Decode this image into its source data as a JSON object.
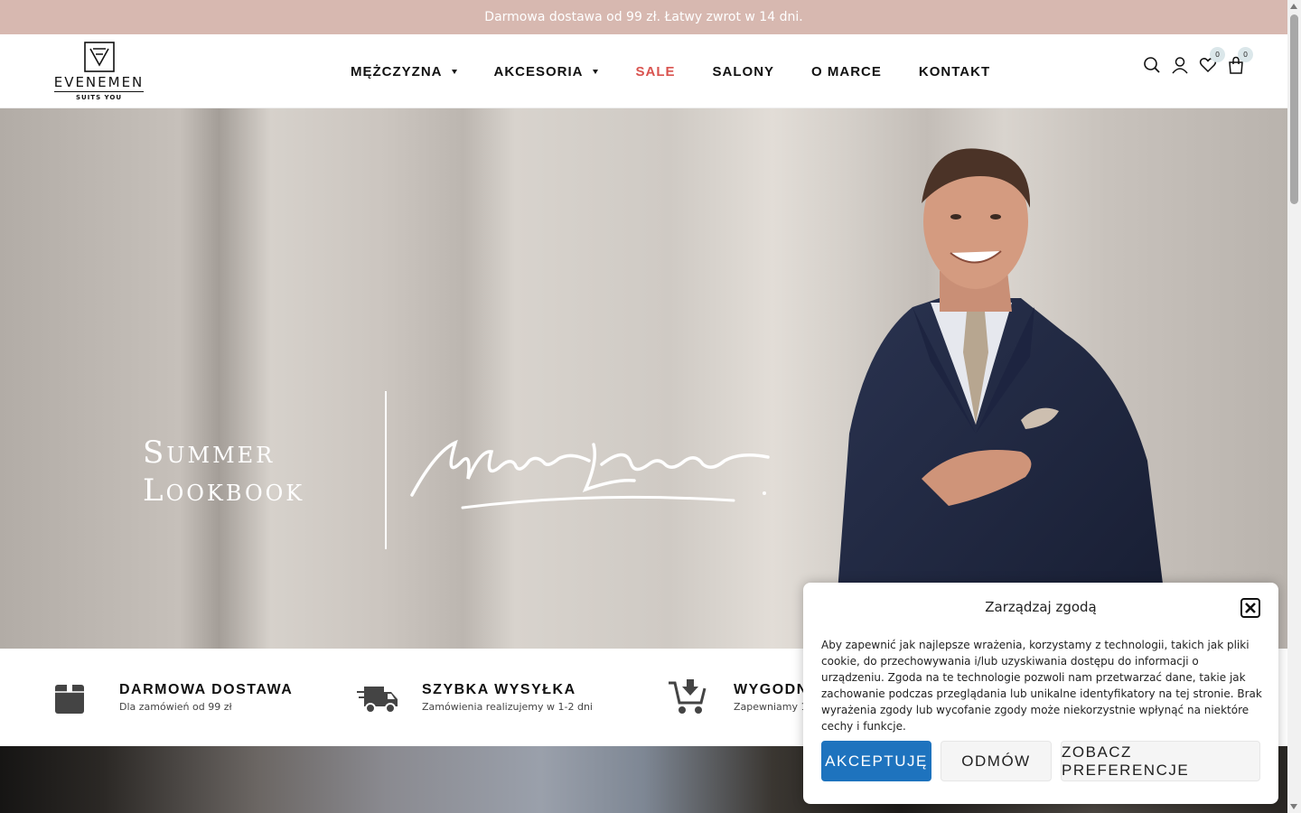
{
  "topbar": {
    "text": "Darmowa dostawa od 99 zł. Łatwy zwrot w 14 dni."
  },
  "logo": {
    "wordmark": "EVENEMEN",
    "tagline": "SUITS YOU"
  },
  "nav": {
    "items": [
      {
        "label": "MĘŻCZYZNA",
        "has_dropdown": true
      },
      {
        "label": "AKCESORIA",
        "has_dropdown": true
      },
      {
        "label": "SALE",
        "has_dropdown": false,
        "color": "#d9534f"
      },
      {
        "label": "SALONY",
        "has_dropdown": false
      },
      {
        "label": "O MARCE",
        "has_dropdown": false
      },
      {
        "label": "KONTAKT",
        "has_dropdown": false
      }
    ]
  },
  "header_icons": {
    "search": "search-icon",
    "account": "user-icon",
    "wishlist": {
      "icon": "heart-icon",
      "count": "0"
    },
    "cart": {
      "icon": "bag-icon",
      "count": "0"
    }
  },
  "hero": {
    "line1": "Summer",
    "line2": "Lookbook",
    "signature": "Marcin Kaliszuk"
  },
  "features": [
    {
      "icon": "box-icon",
      "title": "DARMOWA DOSTAWA",
      "subtitle": "Dla zamówień od 99 zł"
    },
    {
      "icon": "truck-icon",
      "title": "SZYBKA WYSYŁKA",
      "subtitle": "Zamówienia realizujemy w 1-2 dni"
    },
    {
      "icon": "cart-download-icon",
      "title": "WYGODN",
      "subtitle": "Zapewniamy 1"
    }
  ],
  "cookie": {
    "title": "Zarządzaj zgodą",
    "text": "Aby zapewnić jak najlepsze wrażenia, korzystamy z technologii, takich jak pliki cookie, do przechowywania i/lub uzyskiwania dostępu do informacji o urządzeniu. Zgoda na te technologie pozwoli nam przetwarzać dane, takie jak zachowanie podczas przeglądania lub unikalne identyfikatory na tej stronie. Brak wyrażenia zgody lub wycofanie zgody może niekorzystnie wpłynąć na niektóre cechy i funkcje.",
    "accept": "AKCEPTUJĘ",
    "deny": "ODMÓW",
    "preferences": "ZOBACZ PREFERENCJE"
  },
  "colors": {
    "topbar": "#d7b8b0",
    "accent": "#1e73be",
    "sale": "#d9534f"
  }
}
